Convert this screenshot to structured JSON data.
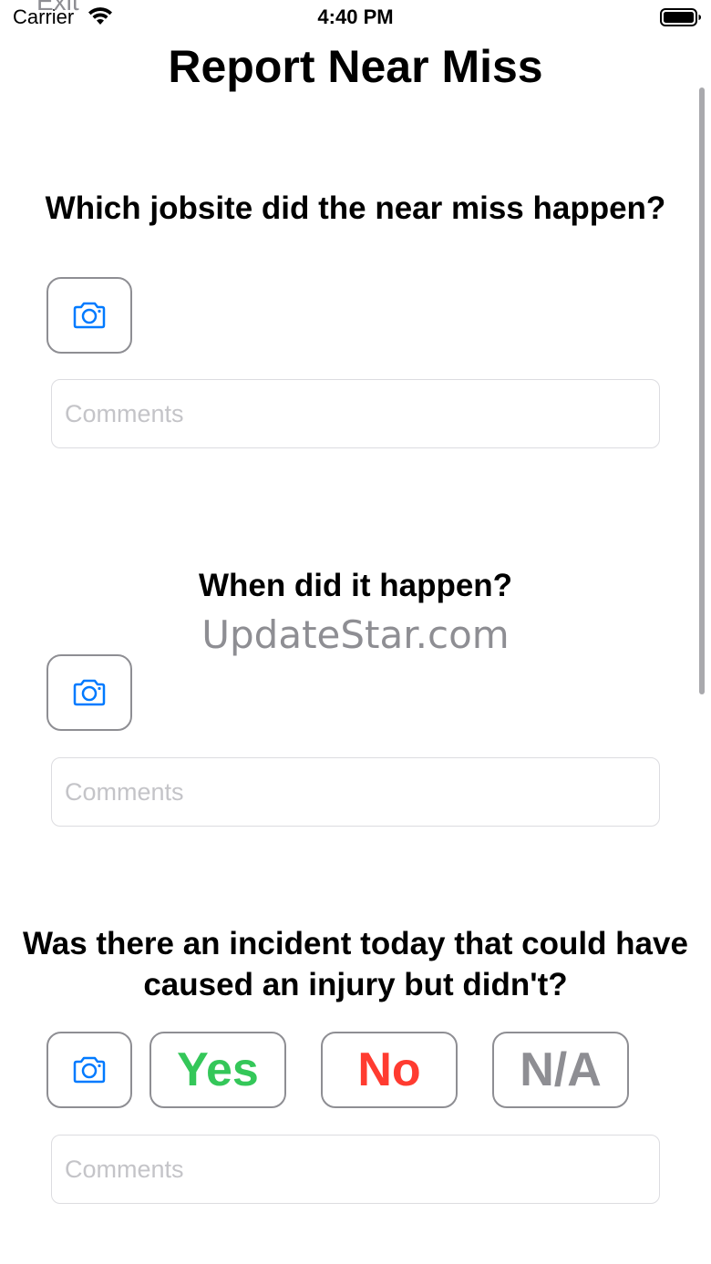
{
  "status_bar": {
    "carrier": "Carrier",
    "time": "4:40 PM"
  },
  "nav": {
    "exit_label": "Exit",
    "title": "Report Near Miss"
  },
  "questions": [
    {
      "text": "Which jobsite did the near miss happen?",
      "comment_placeholder": "Comments"
    },
    {
      "text": "When did it happen?",
      "comment_placeholder": "Comments"
    },
    {
      "text": "Was there an incident today that could have caused an injury but didn't?",
      "answers": {
        "yes": "Yes",
        "no": "No",
        "na": "N/A"
      },
      "comment_placeholder": "Comments"
    }
  ],
  "watermark": "UpdateStar.com",
  "colors": {
    "accent": "#007aff",
    "yes": "#34c759",
    "no": "#ff3b30",
    "na": "#8e8e93",
    "button_border": "#8e8e93",
    "placeholder": "#c4c4c8"
  },
  "icons": {
    "camera": "camera-icon",
    "wifi": "wifi-icon",
    "battery": "battery-icon"
  }
}
